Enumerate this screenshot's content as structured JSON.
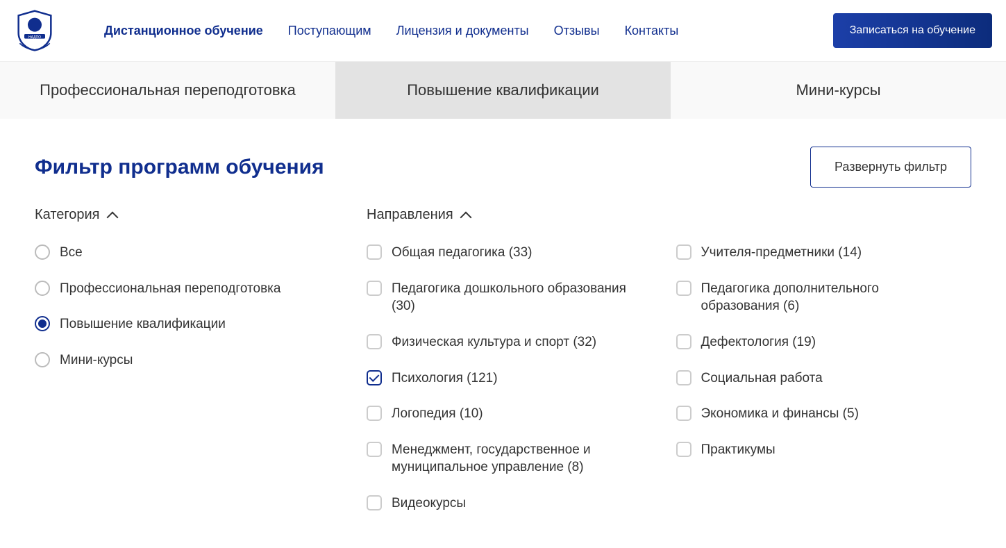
{
  "header": {
    "nav": [
      {
        "label": "Дистанционное обучение",
        "active": true
      },
      {
        "label": "Поступающим",
        "active": false
      },
      {
        "label": "Лицензия и документы",
        "active": false
      },
      {
        "label": "Отзывы",
        "active": false
      },
      {
        "label": "Контакты",
        "active": false
      }
    ],
    "cta": "Записаться на обучение"
  },
  "tabs": [
    {
      "label": "Профессиональная переподготовка",
      "active": false
    },
    {
      "label": "Повышение квалификации",
      "active": true
    },
    {
      "label": "Мини-курсы",
      "active": false
    }
  ],
  "filter": {
    "title": "Фильтр программ обучения",
    "expand": "Развернуть фильтр",
    "category_head": "Категория",
    "directions_head": "Направления",
    "categories": [
      {
        "label": "Все",
        "checked": false
      },
      {
        "label": "Профессиональная переподготовка",
        "checked": false
      },
      {
        "label": "Повышение квалификации",
        "checked": true
      },
      {
        "label": "Мини-курсы",
        "checked": false
      }
    ],
    "directions_col1": [
      {
        "label": "Общая педагогика (33)",
        "checked": false
      },
      {
        "label": "Педагогика дошкольного образования (30)",
        "checked": false
      },
      {
        "label": "Физическая культура и спорт (32)",
        "checked": false
      },
      {
        "label": "Психология (121)",
        "checked": true
      },
      {
        "label": "Логопедия (10)",
        "checked": false
      },
      {
        "label": "Менеджмент, государственное и муниципальное управление (8)",
        "checked": false
      },
      {
        "label": "Видеокурсы",
        "checked": false
      }
    ],
    "directions_col2": [
      {
        "label": "Учителя-предметники (14)",
        "checked": false
      },
      {
        "label": "Педагогика дополнительного образования (6)",
        "checked": false
      },
      {
        "label": "Дефектология (19)",
        "checked": false
      },
      {
        "label": "Социальная работа",
        "checked": false
      },
      {
        "label": "Экономика и финансы (5)",
        "checked": false
      },
      {
        "label": "Практикумы",
        "checked": false
      }
    ]
  }
}
